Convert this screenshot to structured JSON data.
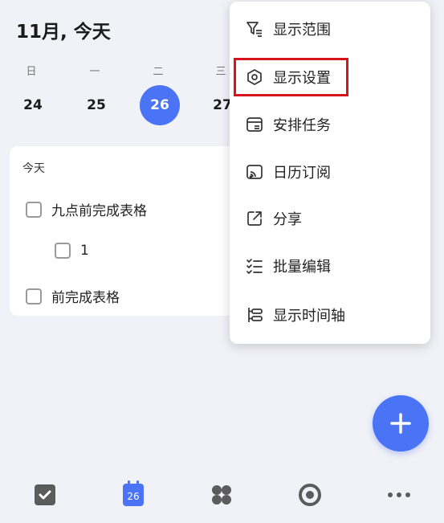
{
  "header": {
    "title": "11月, 今天"
  },
  "week": {
    "labels": [
      "日",
      "一",
      "二",
      "三"
    ],
    "dates": [
      "24",
      "25",
      "26",
      "27"
    ],
    "selected_index": 2
  },
  "today_card": {
    "title": "今天",
    "tasks": [
      {
        "label": "九点前完成表格",
        "level": 0
      },
      {
        "label": "1",
        "level": 1
      },
      {
        "label": "前完成表格",
        "level": 0
      }
    ]
  },
  "menu": {
    "items": [
      {
        "label": "显示范围",
        "icon": "filter-icon"
      },
      {
        "label": "显示设置",
        "icon": "display-settings-icon"
      },
      {
        "label": "安排任务",
        "icon": "arrange-task-icon"
      },
      {
        "label": "日历订阅",
        "icon": "calendar-subscribe-icon"
      },
      {
        "label": "分享",
        "icon": "share-icon"
      },
      {
        "label": "批量编辑",
        "icon": "batch-edit-icon"
      },
      {
        "label": "显示时间轴",
        "icon": "timeline-icon"
      }
    ],
    "highlighted_index": 1
  },
  "fab": {
    "icon": "plus-icon"
  },
  "bottom_nav": {
    "calendar_day": "26",
    "items": [
      "task-checkbox-icon",
      "calendar-icon",
      "grid-icon",
      "focus-icon",
      "more-icon"
    ]
  },
  "colors": {
    "accent": "#4a74f5",
    "highlight": "#d6141e",
    "background": "#f1f2f7"
  }
}
